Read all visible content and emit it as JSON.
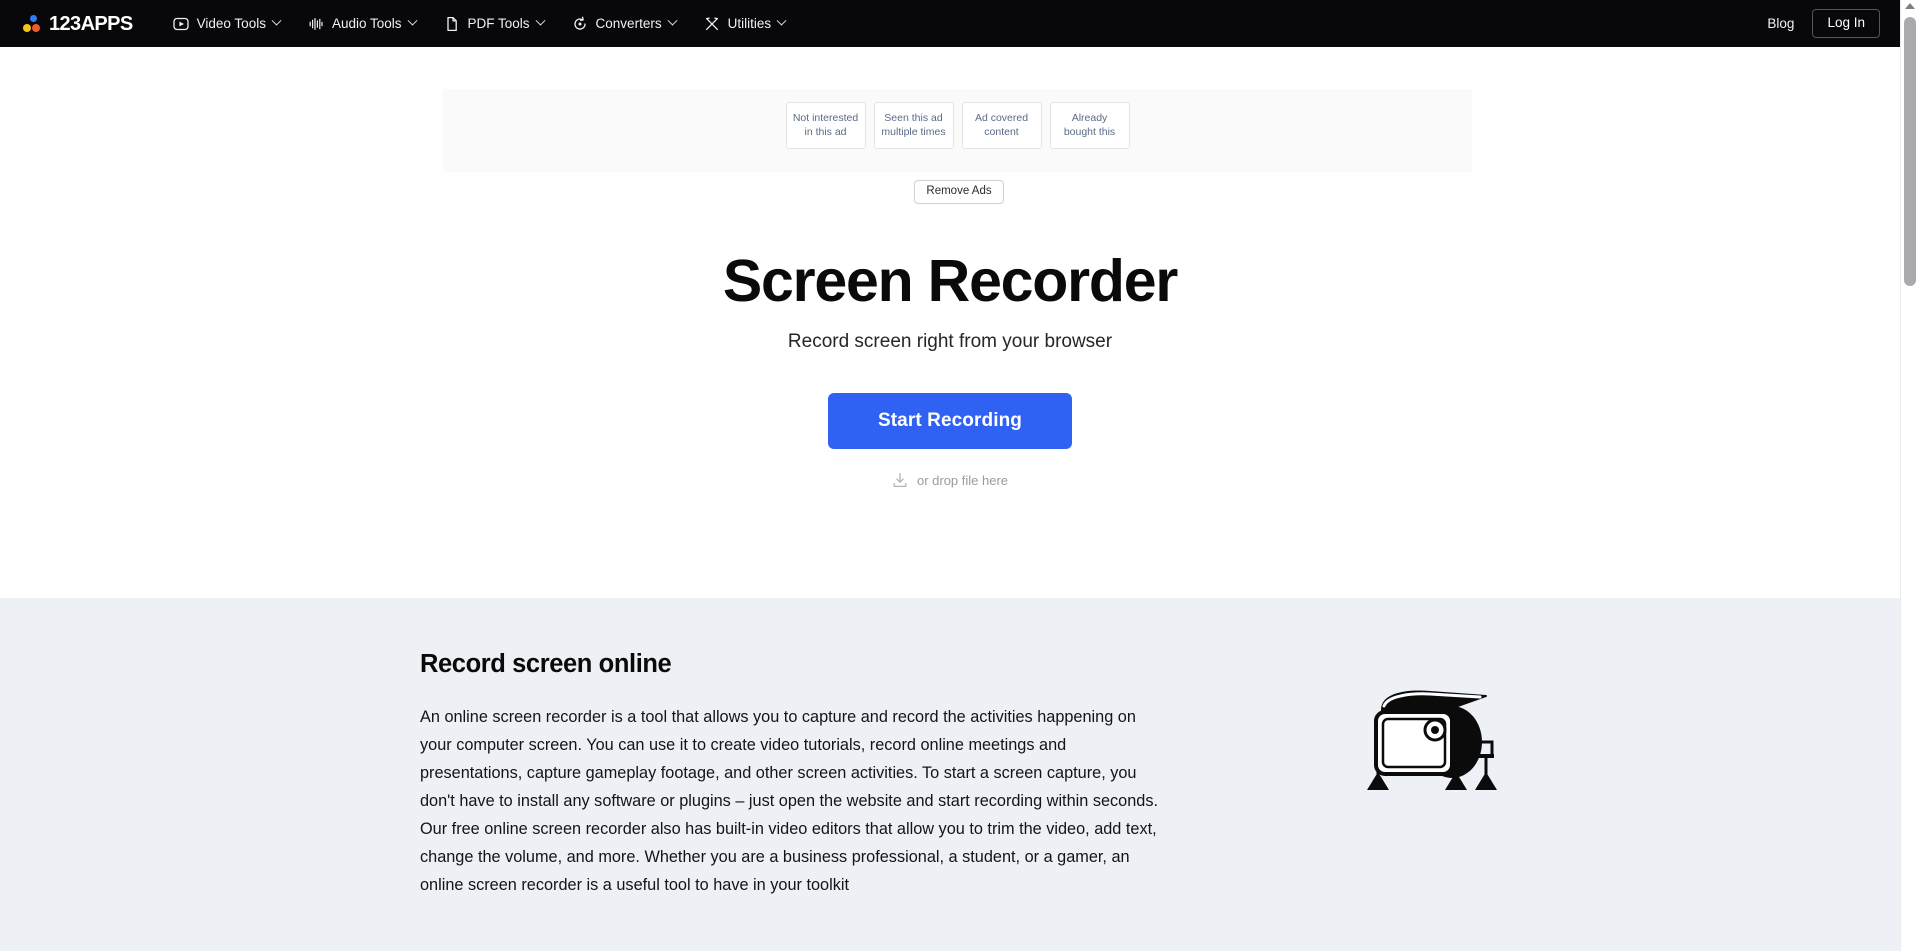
{
  "navbar": {
    "logo_text": "123APPS",
    "logo_dots": [
      "#2f7cf6",
      "#f5c518",
      "#ef5a28"
    ],
    "items": [
      {
        "label": "Video Tools",
        "icon": "play-square-icon",
        "caret": true
      },
      {
        "label": "Audio Tools",
        "icon": "waveform-icon",
        "caret": true
      },
      {
        "label": "PDF Tools",
        "icon": "document-icon",
        "caret": true
      },
      {
        "label": "Converters",
        "icon": "refresh-circle-icon",
        "caret": true
      },
      {
        "label": "Utilities",
        "icon": "crossed-tools-icon",
        "caret": true
      }
    ],
    "blog_label": "Blog",
    "login_label": "Log In"
  },
  "ad": {
    "feedback_buttons": [
      "Not interested in this ad",
      "Seen this ad multiple times",
      "Ad covered content",
      "Already bought this"
    ],
    "remove_ads_label": "Remove Ads"
  },
  "hero": {
    "title": "Screen Recorder",
    "subtitle": "Record screen right from your browser",
    "cta_label": "Start Recording",
    "drop_text": "or drop file here",
    "drop_icon": "download-tray-icon",
    "cta_color": "#2f62f3"
  },
  "info": {
    "title": "Record screen online",
    "body": "An online screen recorder is a tool that allows you to capture and record the activities happening on your computer screen. You can use it to create video tutorials, record online meetings and presentations, capture gameplay footage, and other screen activities. To start a screen capture, you don't have to install any software or plugins – just open the website and start recording within seconds. Our free online screen recorder also has built-in video editors that allow you to trim the video, add text, change the volume, and more. Whether you are a business professional, a student, or a gamer, an online screen recorder is a useful tool to have in your toolkit",
    "illustration": "screen-recorder-device-illustration",
    "background_color": "#edf1f5"
  }
}
